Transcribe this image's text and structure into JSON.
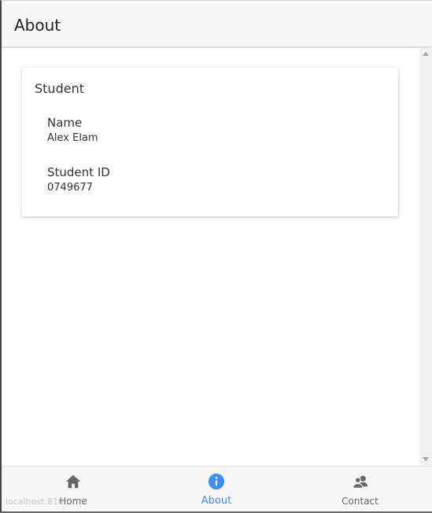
{
  "header": {
    "title": "About"
  },
  "card": {
    "title": "Student",
    "items": [
      {
        "label": "Name",
        "value": "Alex Elam"
      },
      {
        "label": "Student ID",
        "value": "0749677"
      }
    ]
  },
  "tabs": [
    {
      "label": "Home",
      "icon": "home-icon",
      "active": false
    },
    {
      "label": "About",
      "icon": "info-icon",
      "active": true
    },
    {
      "label": "Contact",
      "icon": "contacts-icon",
      "active": false
    }
  ],
  "status_bar": {
    "url": "localhost:810"
  },
  "colors": {
    "accent": "#3e8ef7",
    "icon_inactive": "#666666"
  }
}
